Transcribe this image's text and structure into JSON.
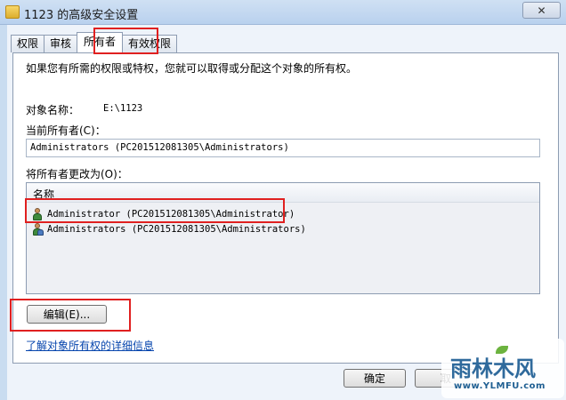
{
  "window": {
    "title": "1123 的高级安全设置",
    "close_label": "✕"
  },
  "tabs": [
    {
      "label": "权限"
    },
    {
      "label": "审核"
    },
    {
      "label": "所有者"
    },
    {
      "label": "有效权限"
    }
  ],
  "owner": {
    "intro": "如果您有所需的权限或特权，您就可以取得或分配这个对象的所有权。",
    "object_name_label": "对象名称：",
    "object_name_value": "E:\\1123",
    "current_owner_label": "当前所有者(C)：",
    "current_owner_value": "Administrators (PC201512081305\\Administrators)",
    "change_owner_label": "将所有者更改为(O)：",
    "list_header": "名称",
    "list_items": [
      {
        "name": "Administrator (PC201512081305\\Administrator)",
        "icon": "user-icon"
      },
      {
        "name": "Administrators (PC201512081305\\Administrators)",
        "icon": "group-icon"
      }
    ],
    "edit_button": "编辑(E)...",
    "learn_more_link": "了解对象所有权的详细信息"
  },
  "footer": {
    "ok_button": "确定",
    "cancel_button": "取"
  },
  "watermark": {
    "logo": "雨林木风",
    "url": "www.YLMFU.com"
  },
  "colors": {
    "highlight": "#e02020",
    "link": "#0645ad",
    "frame": "#eef3fa"
  }
}
